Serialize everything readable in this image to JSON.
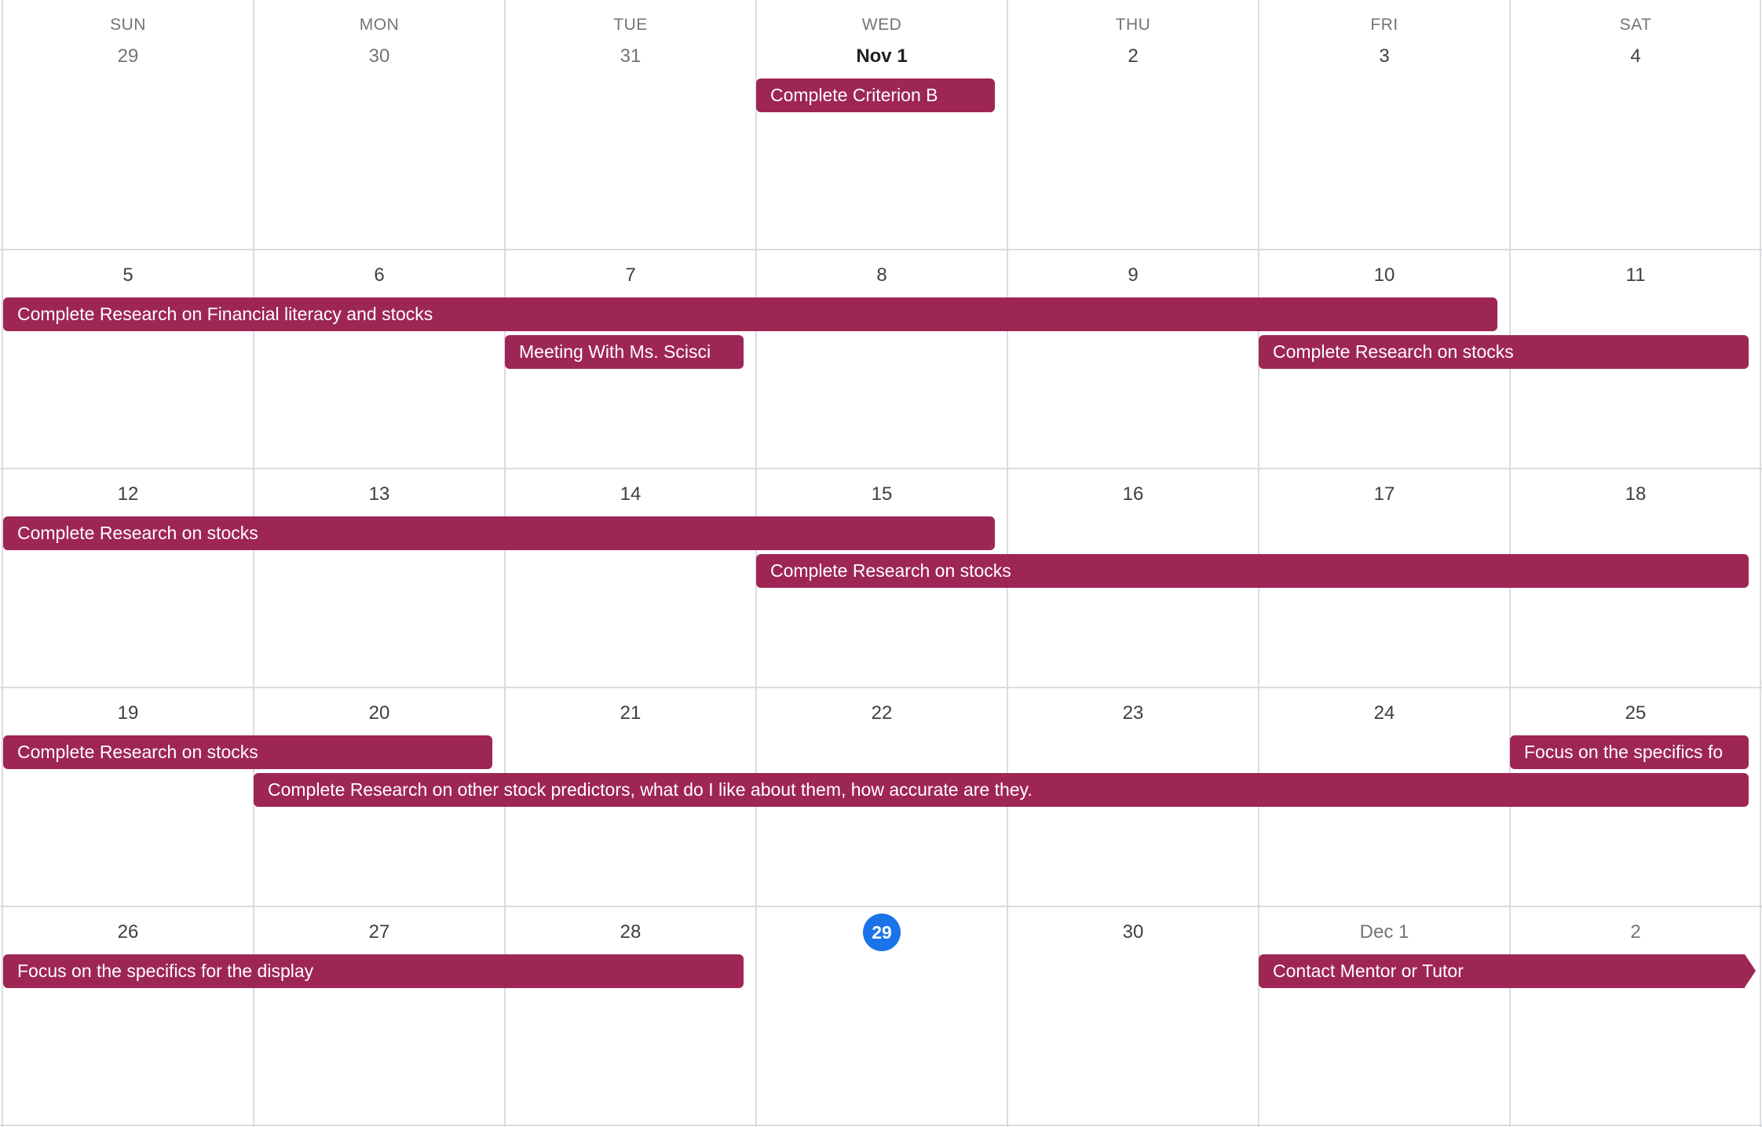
{
  "calendar": {
    "weekdays": [
      "SUN",
      "MON",
      "TUE",
      "WED",
      "THU",
      "FRI",
      "SAT"
    ],
    "weeks": [
      {
        "days": [
          "29",
          "30",
          "31",
          "Nov 1",
          "2",
          "3",
          "4"
        ]
      },
      {
        "days": [
          "5",
          "6",
          "7",
          "8",
          "9",
          "10",
          "11"
        ]
      },
      {
        "days": [
          "12",
          "13",
          "14",
          "15",
          "16",
          "17",
          "18"
        ]
      },
      {
        "days": [
          "19",
          "20",
          "21",
          "22",
          "23",
          "24",
          "25"
        ]
      },
      {
        "days": [
          "26",
          "27",
          "28",
          "29",
          "30",
          "Dec 1",
          "2"
        ]
      }
    ],
    "events": [
      {
        "title": "Complete Criterion B"
      },
      {
        "title": "Complete Research on Financial literacy and stocks"
      },
      {
        "title": "Meeting With Ms. Scisci"
      },
      {
        "title": "Complete Research on stocks"
      },
      {
        "title": "Complete Research on stocks"
      },
      {
        "title": "Complete Research on stocks"
      },
      {
        "title": "Complete Research on stocks"
      },
      {
        "title": "Focus on the specifics fo"
      },
      {
        "title": "Complete Research on other stock predictors, what do I like about them, how accurate are they."
      },
      {
        "title": "Focus on the specifics for the display"
      },
      {
        "title": "Contact Mentor or Tutor"
      }
    ],
    "event_color": "#9e2654",
    "today_color": "#1a73e8"
  }
}
